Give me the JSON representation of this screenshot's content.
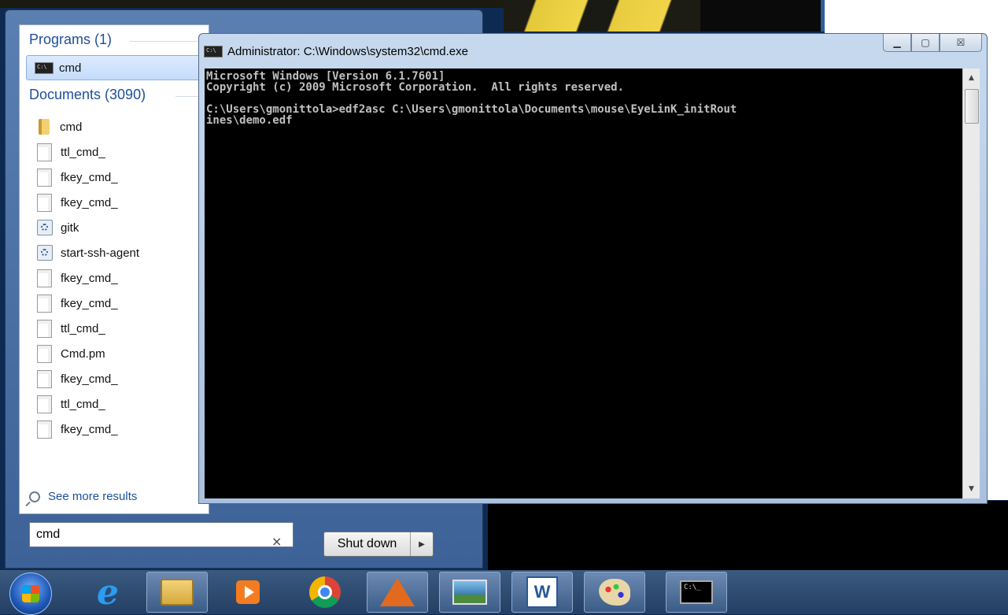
{
  "start_menu": {
    "programs_header": "Programs (1)",
    "program_items": [
      {
        "label": "cmd",
        "icon": "cmd-icon"
      }
    ],
    "documents_header": "Documents (3090)",
    "document_items": [
      {
        "label": "cmd",
        "icon": "folder-icon"
      },
      {
        "label": "ttl_cmd_",
        "icon": "document-icon"
      },
      {
        "label": "fkey_cmd_",
        "icon": "document-icon"
      },
      {
        "label": "fkey_cmd_",
        "icon": "document-icon"
      },
      {
        "label": "gitk",
        "icon": "script-icon"
      },
      {
        "label": "start-ssh-agent",
        "icon": "script-icon"
      },
      {
        "label": "fkey_cmd_",
        "icon": "document-icon"
      },
      {
        "label": "fkey_cmd_",
        "icon": "document-icon"
      },
      {
        "label": "ttl_cmd_",
        "icon": "document-icon"
      },
      {
        "label": "Cmd.pm",
        "icon": "document-icon"
      },
      {
        "label": "fkey_cmd_",
        "icon": "document-icon"
      },
      {
        "label": "ttl_cmd_",
        "icon": "document-icon"
      },
      {
        "label": "fkey_cmd_",
        "icon": "document-icon"
      }
    ],
    "see_more": "See more results",
    "search_value": "cmd",
    "clear_glyph": "×",
    "shutdown_label": "Shut down",
    "shutdown_arrow": "▶"
  },
  "cmd_window": {
    "title": "Administrator: C:\\Windows\\system32\\cmd.exe",
    "minimize_glyph": "▁",
    "maximize_glyph": "▢",
    "close_glyph": "☒",
    "console_text": "Microsoft Windows [Version 6.1.7601]\nCopyright (c) 2009 Microsoft Corporation.  All rights reserved.\n\nC:\\Users\\gmonittola>edf2asc C:\\Users\\gmonittola\\Documents\\mouse\\EyeLinK_initRout\nines\\demo.edf",
    "scroll_up": "▲",
    "scroll_down": "▼"
  },
  "taskbar": {
    "ie_glyph": "e",
    "word_glyph": "W",
    "cmd_glyph": "C:\\_",
    "items": [
      "internet-explorer-icon",
      "windows-explorer-icon",
      "media-player-icon",
      "chrome-icon",
      "matlab-icon",
      "photo-viewer-icon",
      "word-icon",
      "paint-icon",
      "command-prompt-icon"
    ]
  }
}
